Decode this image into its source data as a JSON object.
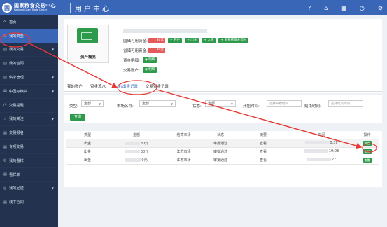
{
  "header": {
    "logo_mark": "国",
    "org_cn": "国家粮食交易中心",
    "org_en": "National Grain Trade Center",
    "page_title": "用户中心",
    "icons": [
      "help-icon",
      "home-icon",
      "grid-icon",
      "bell-icon",
      "settings-icon"
    ],
    "icon_glyphs": [
      "?",
      "⌂",
      "▦",
      "◷",
      "⚙"
    ]
  },
  "sidebar": {
    "items": [
      {
        "label": "首页",
        "icon": "home-icon",
        "glyph": "⌂",
        "arrow": ""
      },
      {
        "label": "我的资金",
        "icon": "wallet-icon",
        "glyph": "◎",
        "arrow": ""
      },
      {
        "label": "我的交易",
        "icon": "trade-icon",
        "glyph": "▤",
        "arrow": "▼"
      },
      {
        "label": "我的合同",
        "icon": "contract-icon",
        "glyph": "▤",
        "arrow": ""
      },
      {
        "label": "供求管理",
        "icon": "supply-icon",
        "glyph": "▤",
        "arrow": "▼"
      },
      {
        "label": "中国好粮油",
        "icon": "grain-icon",
        "glyph": "▤",
        "arrow": "▼"
      },
      {
        "label": "交易提醒",
        "icon": "reminder-icon",
        "glyph": "◷",
        "arrow": ""
      },
      {
        "label": "我的关注",
        "icon": "star-icon",
        "glyph": "☆",
        "arrow": "▼"
      },
      {
        "label": "交易报名",
        "icon": "signup-icon",
        "glyph": "▤",
        "arrow": ""
      },
      {
        "label": "专项交易",
        "icon": "special-icon",
        "glyph": "▤",
        "arrow": ""
      },
      {
        "label": "我的看样",
        "icon": "sample-icon",
        "glyph": "◎",
        "arrow": ""
      },
      {
        "label": "看样单",
        "icon": "sample-list-icon",
        "glyph": "▤",
        "arrow": ""
      },
      {
        "label": "我的足迹",
        "icon": "footprint-icon",
        "glyph": "◎",
        "arrow": "▼"
      },
      {
        "label": "线下合同",
        "icon": "offline-contract-icon",
        "glyph": "▤",
        "arrow": ""
      }
    ]
  },
  "account": {
    "logo_label": "资产概览",
    "rows": [
      {
        "label": "国储可用资金:",
        "amount": "30元",
        "buttons": [
          "开户",
          "出金",
          "入金",
          "旧系统资金调入"
        ]
      },
      {
        "label": "省储可用资金:",
        "amount": "30元",
        "buttons": []
      },
      {
        "label": "资金明细:",
        "amount": "",
        "buttons": [
          "明细"
        ]
      },
      {
        "label": "交易账户:",
        "amount": "",
        "buttons": [
          "明细"
        ]
      }
    ]
  },
  "tabs": [
    "我的账户",
    "资金流水",
    "入金/出金记录",
    "交易资金记录"
  ],
  "filters": {
    "type_label": "类型:",
    "type_value": "全部",
    "market_label": "市场名称:",
    "market_value": "全部",
    "status_label": "状态:",
    "status_value": "全部",
    "start_label": "开始时间:",
    "start_placeholder": "选择开始时间",
    "end_label": "结束时间:",
    "end_placeholder": "选择结束时间",
    "query": "查询"
  },
  "table": {
    "columns": [
      "类型",
      "金额",
      "结算市场",
      "状态",
      "摘要",
      "时间",
      "操作"
    ],
    "rows": [
      {
        "type": "出金",
        "amount": "30元",
        "market": "",
        "status": "审批通过",
        "summary": "查看",
        "time": "0:39",
        "action": "查看"
      },
      {
        "type": "出金",
        "amount": "30元",
        "market": "江苏市场",
        "status": "审批通过",
        "summary": "查看",
        "time": "19:03",
        "action": "查看"
      },
      {
        "type": "出金",
        "amount": "0元",
        "market": "江苏市场",
        "status": "审批通过",
        "summary": "查看",
        "time": "27",
        "action": "查看"
      }
    ]
  },
  "colors": {
    "header_blue": "#3a66b8",
    "sidebar_dark": "#22324f",
    "action_green": "#2e9a4b",
    "amount_red": "#e55b5b",
    "annotation_red": "#e53935"
  }
}
